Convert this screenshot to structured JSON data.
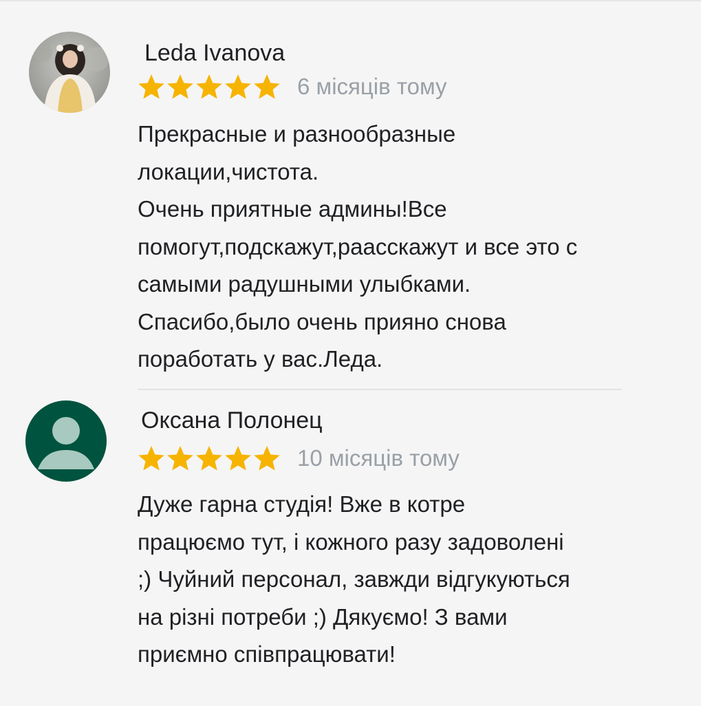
{
  "reviews": [
    {
      "author": "Leda Ivanova",
      "rating": 5,
      "max_rating": 5,
      "time": "6 місяців тому",
      "text": "Прекрасные и разнообразные\nлокации,чистота.\nОчень приятные админы!Все\nпомогут,подскажут,раасскажут и все это с\nсамыми радушными улыбками.\nСпасибо,было очень прияно снова\nпоработать у вас.Леда.",
      "avatar": "photo-avatar"
    },
    {
      "author": "Оксана Полонец",
      "rating": 5,
      "max_rating": 5,
      "time": "10 місяців тому",
      "text": "Дуже гарна студія! Вже в котре\nпрацюємо тут, і кожного разу задоволені\n;) Чуйний персонал, завжди відгукуються\nна різні потреби ;) Дякуємо! З вами\nприємно співпрацювати!",
      "avatar": "default-person-icon"
    }
  ],
  "colors": {
    "star": "#f6b400",
    "default_avatar_bg": "#00533f",
    "default_avatar_fg": "#a8c9bf",
    "text": "#202124",
    "secondary_text": "#9aa0a6",
    "background": "#f5f5f5"
  }
}
